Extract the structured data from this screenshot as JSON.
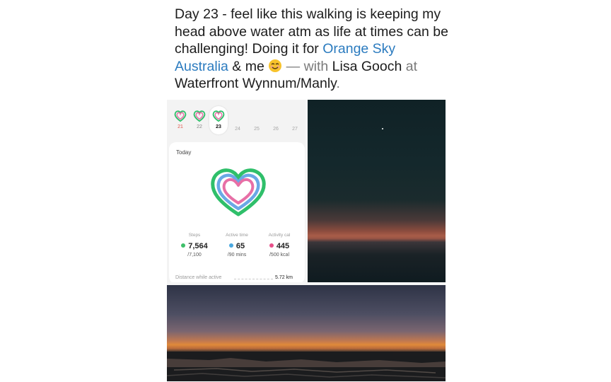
{
  "post": {
    "part1": "Day 23 - feel like this walking is keeping my head above water atm as life at times can be challenging! Doing it for ",
    "link_org": "Orange Sky Australia",
    "part2": " & me ",
    "emoji": "smiling-face-icon",
    "with_word": " — with ",
    "tagged_person": "Lisa Gooch",
    "at_word": " at ",
    "location": "Waterfront Wynnum/Manly",
    "period": "."
  },
  "health": {
    "days": [
      {
        "num": "21",
        "ring": true,
        "color": "#e0564b"
      },
      {
        "num": "22",
        "ring": true,
        "color": "#888888"
      },
      {
        "num": "23",
        "ring": true,
        "color": "#111111",
        "selected": true
      },
      {
        "num": "24",
        "ring": false
      },
      {
        "num": "25",
        "ring": false
      },
      {
        "num": "26",
        "ring": false
      },
      {
        "num": "27",
        "ring": false
      }
    ],
    "card_title": "Today",
    "steps": {
      "label": "Steps",
      "value": "7,564",
      "goal": "/7,100",
      "color": "#3fbf6a"
    },
    "active": {
      "label": "Active time",
      "value": "65",
      "goal": "/90 mins",
      "color": "#4aa8e0"
    },
    "calories": {
      "label": "Activity cal",
      "value": "445",
      "goal": "/500 kcal",
      "color": "#e8508a"
    },
    "distance_label": "Distance while active",
    "distance_value": "5.72 km"
  }
}
